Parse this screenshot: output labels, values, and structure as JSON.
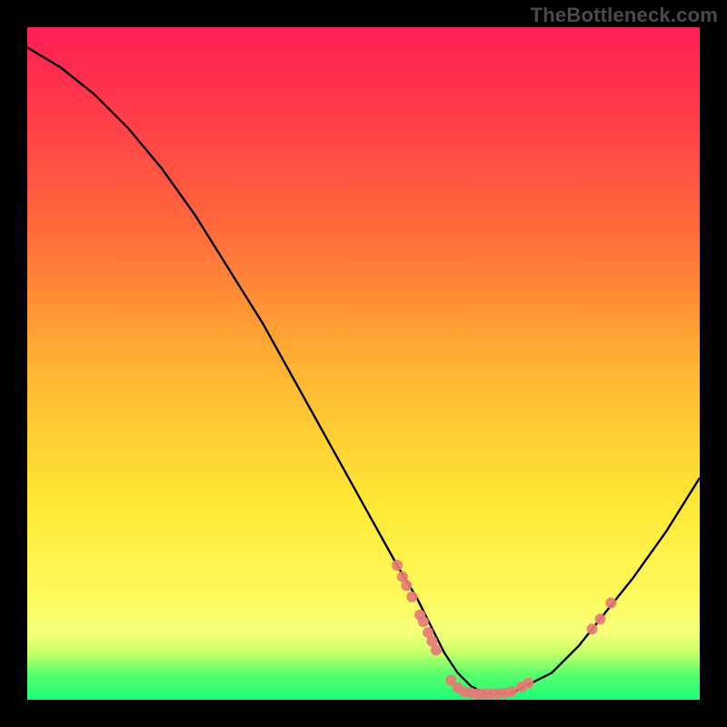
{
  "watermark": "TheBottleneck.com",
  "chart_data": {
    "type": "line",
    "title": "",
    "xlabel": "",
    "ylabel": "",
    "xlim": [
      0,
      100
    ],
    "ylim": [
      0,
      100
    ],
    "series": [
      {
        "name": "bottleneck-curve",
        "x": [
          0,
          5,
          10,
          15,
          20,
          25,
          30,
          35,
          40,
          45,
          50,
          55,
          58,
          60,
          62,
          64,
          66,
          68,
          70,
          72,
          74,
          78,
          82,
          86,
          90,
          95,
          100
        ],
        "y": [
          97,
          94,
          90,
          85,
          79,
          72,
          64,
          56,
          47,
          38,
          29,
          20,
          15,
          11,
          7,
          4,
          2,
          1,
          1,
          1,
          2,
          4,
          8,
          13,
          18,
          25,
          33
        ]
      }
    ],
    "markers": {
      "name": "sample-points",
      "color": "#e87a76",
      "points": [
        {
          "x": 55.0,
          "y": 20.0
        },
        {
          "x": 55.8,
          "y": 18.3
        },
        {
          "x": 56.4,
          "y": 17.0
        },
        {
          "x": 57.2,
          "y": 15.3
        },
        {
          "x": 58.4,
          "y": 12.6
        },
        {
          "x": 58.9,
          "y": 11.6
        },
        {
          "x": 59.6,
          "y": 10.0
        },
        {
          "x": 60.2,
          "y": 8.7
        },
        {
          "x": 60.8,
          "y": 7.4
        },
        {
          "x": 63.0,
          "y": 2.9
        },
        {
          "x": 64.0,
          "y": 1.8
        },
        {
          "x": 65.0,
          "y": 1.2
        },
        {
          "x": 66.0,
          "y": 1.0
        },
        {
          "x": 67.0,
          "y": 0.9
        },
        {
          "x": 68.0,
          "y": 0.9
        },
        {
          "x": 69.0,
          "y": 0.9
        },
        {
          "x": 70.0,
          "y": 0.9
        },
        {
          "x": 71.0,
          "y": 1.0
        },
        {
          "x": 72.0,
          "y": 1.2
        },
        {
          "x": 73.5,
          "y": 1.9
        },
        {
          "x": 74.5,
          "y": 2.5
        },
        {
          "x": 84.0,
          "y": 10.5
        },
        {
          "x": 85.2,
          "y": 12.0
        },
        {
          "x": 86.8,
          "y": 14.4
        }
      ]
    },
    "gradient_stops": [
      {
        "pos": 0.0,
        "color": "#ff1f56"
      },
      {
        "pos": 0.12,
        "color": "#ff3a4a"
      },
      {
        "pos": 0.3,
        "color": "#ff6a3b"
      },
      {
        "pos": 0.5,
        "color": "#ffb133"
      },
      {
        "pos": 0.7,
        "color": "#ffe733"
      },
      {
        "pos": 0.84,
        "color": "#fff95a"
      },
      {
        "pos": 0.9,
        "color": "#f6ff7a"
      },
      {
        "pos": 0.93,
        "color": "#c7ff6a"
      },
      {
        "pos": 0.96,
        "color": "#5cff6a"
      },
      {
        "pos": 1.0,
        "color": "#1bff77"
      }
    ]
  }
}
